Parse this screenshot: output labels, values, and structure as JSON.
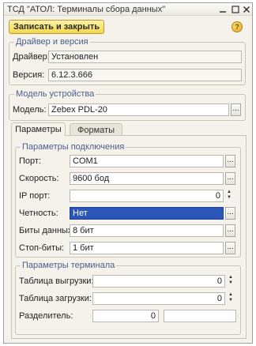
{
  "window": {
    "title": "ТСД \"АТОЛ: Терминалы сбора данных\"",
    "minimize_glyph": "□",
    "close_glyph": "✕"
  },
  "toolbar": {
    "save_close_label": "Записать и закрыть",
    "help_glyph": "?"
  },
  "driver_group": {
    "title": "Драйвер и версия",
    "driver_label": "Драйвер:",
    "driver_value": "Установлен",
    "version_label": "Версия:",
    "version_value": "6.12.3.666"
  },
  "model_group": {
    "title": "Модель устройства",
    "model_label": "Модель:",
    "model_value": "Zebex PDL-20",
    "select_glyph": "..."
  },
  "tabs": [
    {
      "label": "Параметры",
      "active": true
    },
    {
      "label": "Форматы",
      "active": false
    }
  ],
  "connection_group": {
    "title": "Параметры подключения",
    "port_label": "Порт:",
    "port_value": "COM1",
    "speed_label": "Скорость:",
    "speed_value": "9600 бод",
    "ip_port_label": "IP порт:",
    "ip_port_value": "0",
    "parity_label": "Четность:",
    "parity_value": "Нет",
    "data_bits_label": "Биты данных:",
    "data_bits_value": "8 бит",
    "stop_bits_label": "Стоп-биты:",
    "stop_bits_value": "1 бит"
  },
  "terminal_group": {
    "title": "Параметры терминала",
    "upload_table_label": "Таблица выгрузки:",
    "upload_table_value": "0",
    "download_table_label": "Таблица загрузки:",
    "download_table_value": "0",
    "separator_label": "Разделитель:",
    "separator_value": "0",
    "separator_text_value": ""
  },
  "icons": {
    "select": "...",
    "spin_up": "▲",
    "spin_down": "▼"
  }
}
